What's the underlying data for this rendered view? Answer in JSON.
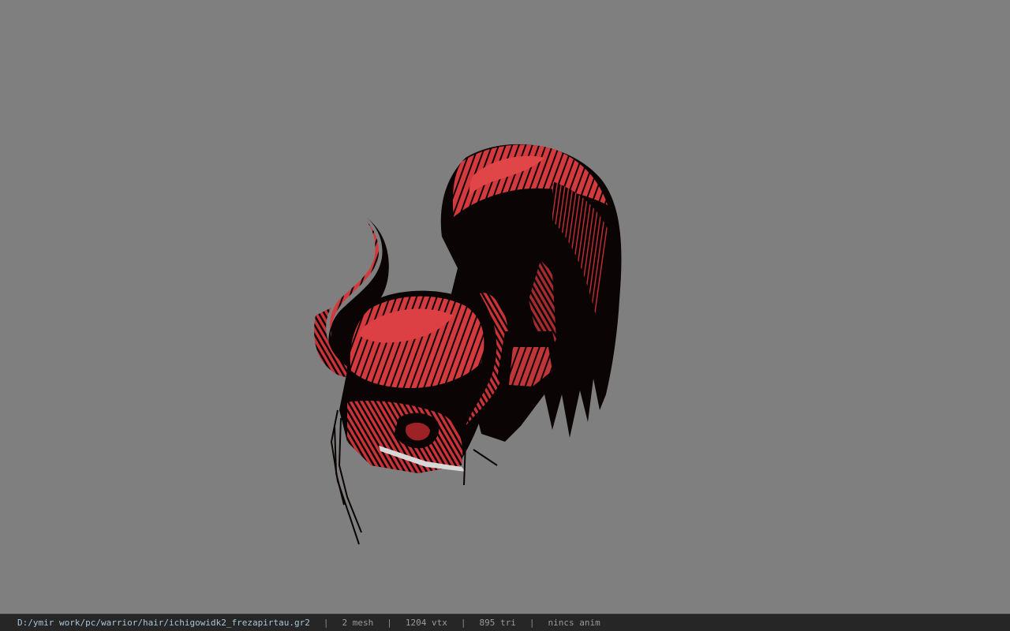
{
  "viewport": {
    "background_color": "#7f7f7f",
    "model_colors": {
      "red": "#d43a3d",
      "dark_red": "#8a1c1f",
      "black": "#0a0404"
    }
  },
  "statusbar": {
    "file_path": "D:/ymir work/pc/warrior/hair/ichigowidk2_frezapirtau.gr2",
    "separator": "|",
    "mesh_count": "2 mesh",
    "vertex_count": "1204 vtx",
    "triangle_count": "895 tri",
    "animation": "nincs anim"
  }
}
